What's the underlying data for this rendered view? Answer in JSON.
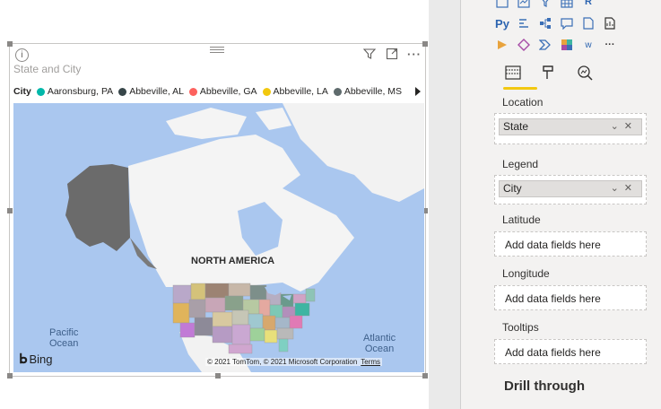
{
  "visual": {
    "title": "State and City",
    "legend_title": "City",
    "legend_items": [
      {
        "label": "Aaronsburg, PA",
        "color": "#01b8aa"
      },
      {
        "label": "Abbeville, AL",
        "color": "#374649"
      },
      {
        "label": "Abbeville, GA",
        "color": "#fd625e"
      },
      {
        "label": "Abbeville, LA",
        "color": "#f2c80f"
      },
      {
        "label": "Abbeville, MS",
        "color": "#5f6b6d"
      }
    ],
    "map_labels": {
      "north_america": "NORTH AMERICA",
      "pacific_1": "Pacific",
      "pacific_2": "Ocean",
      "atlantic_1": "Atlantic",
      "atlantic_2": "Ocean"
    },
    "bing_label": "Bing",
    "copyright": "© 2021 TomTom, © 2021 Microsoft Corporation",
    "terms_link": "Terms",
    "icons": [
      "info-icon",
      "filter-icon",
      "focus-mode-icon",
      "more-options-icon"
    ]
  },
  "panel": {
    "visual_icon_labels": {
      "py": "Py",
      "r": "R",
      "w": "w",
      "more": "···"
    },
    "sections": {
      "location": {
        "label": "Location",
        "field": "State"
      },
      "legend": {
        "label": "Legend",
        "field": "City"
      },
      "latitude": {
        "label": "Latitude",
        "placeholder": "Add data fields here"
      },
      "longitude": {
        "label": "Longitude",
        "placeholder": "Add data fields here"
      },
      "tooltips": {
        "label": "Tooltips",
        "placeholder": "Add data fields here"
      }
    },
    "drill_through": "Drill through",
    "accent_color": "#f2c811"
  }
}
